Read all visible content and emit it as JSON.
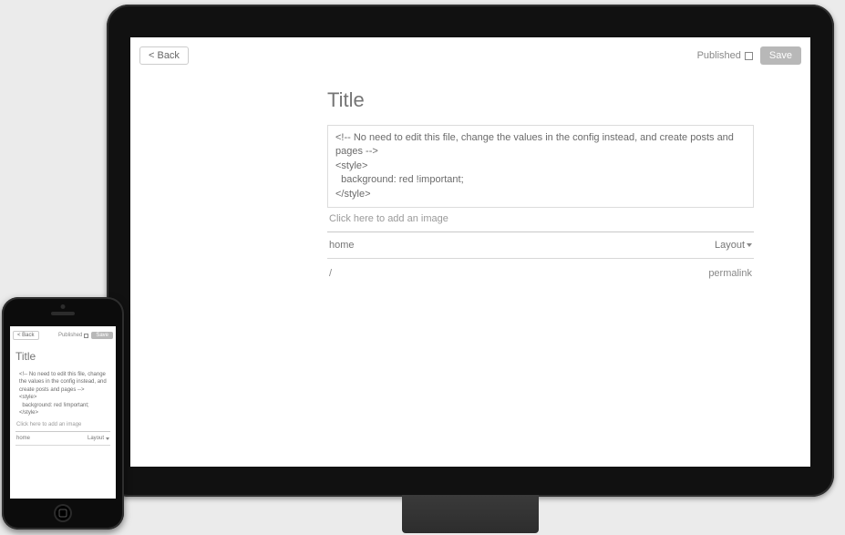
{
  "topbar": {
    "back_label": "< Back",
    "published_label": "Published",
    "save_label": "Save"
  },
  "editor": {
    "title_placeholder": "Title",
    "title_value": "",
    "body": "<!-- No need to edit this file, change the values in the config instead, and create posts and pages -->\n<style>\n  background: red !important;\n</style>",
    "add_image_label": "Click here to add an image"
  },
  "meta": {
    "tag": "home",
    "layout_label": "Layout",
    "slug": "/",
    "permalink_label": "permalink"
  }
}
